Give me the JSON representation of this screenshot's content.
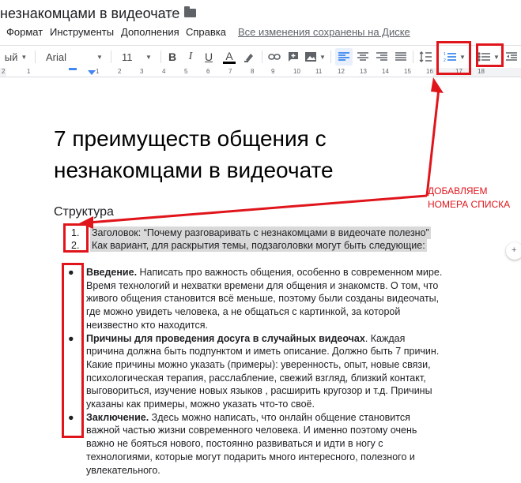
{
  "titlebar": {
    "doc_title": "незнакомцами в видеочате",
    "star_icon": "☆"
  },
  "menu": {
    "items": [
      "Формат",
      "Инструменты",
      "Дополнения",
      "Справка"
    ],
    "save_status": "Все изменения сохранены на Диске"
  },
  "toolbar": {
    "style_partial": "ый",
    "font": "Arial",
    "size": "11",
    "bold": "B",
    "italic": "I",
    "underline": "U",
    "text_color": "A"
  },
  "ruler": {
    "numbers": [
      "2",
      "1",
      "1",
      "2",
      "3",
      "4",
      "5",
      "6",
      "7",
      "8",
      "9",
      "10",
      "11",
      "12",
      "13",
      "14",
      "15",
      "16",
      "17",
      "18"
    ]
  },
  "document": {
    "title": "7 преимуществ общения с незнакомцами в видеочате",
    "subtitle": "Структура",
    "numbered_list": [
      {
        "num": "1.",
        "text": "Заголовок: “Почему разговаривать с незнакомцами в видеочате полезно”"
      },
      {
        "num": "2.",
        "text": "Как вариант, для раскрытия темы, подзаголовки могут быть следующие:"
      }
    ],
    "bullet_list": [
      {
        "bold": "Введение.",
        "text": " Написать про важность общения, особенно в современном мире. Время технологий и нехватки времени для общения и знакомств. О том, что живого общения становится всё меньше, поэтому были созданы видеочаты, где можно увидеть человека, а не общаться с картинкой, за которой неизвестно кто находится."
      },
      {
        "bold": "Причины для проведения досуга в случайных видеочах",
        "text": ". Каждая причина должна быть подпунктом и иметь описание. Должно быть 7 причин.",
        "extra": "Какие причины можно указать (примеры): уверенность, опыт, новые связи, психологическая терапия, расслабление, свежий взгляд, близкий контакт, выговориться, изучение новых языков , расширить кругозор и т.д. Причины указаны как примеры, можно указать что-то своё."
      },
      {
        "bold": "Заключение.",
        "text": " Здесь можно написать, что онлайн общение становится важной частью жизни современного человека. И именно поэтому очень важно не бояться нового, постоянно развиваться и идти в ногу с технологиями, которые могут подарить много интересного, полезного и увлекательного."
      }
    ],
    "bullet_char": "●"
  },
  "annotation": {
    "text_line1": "ДОБАВЛЯЕМ",
    "text_line2": "НОМЕРА СПИСКА",
    "color": "#e0151b"
  }
}
